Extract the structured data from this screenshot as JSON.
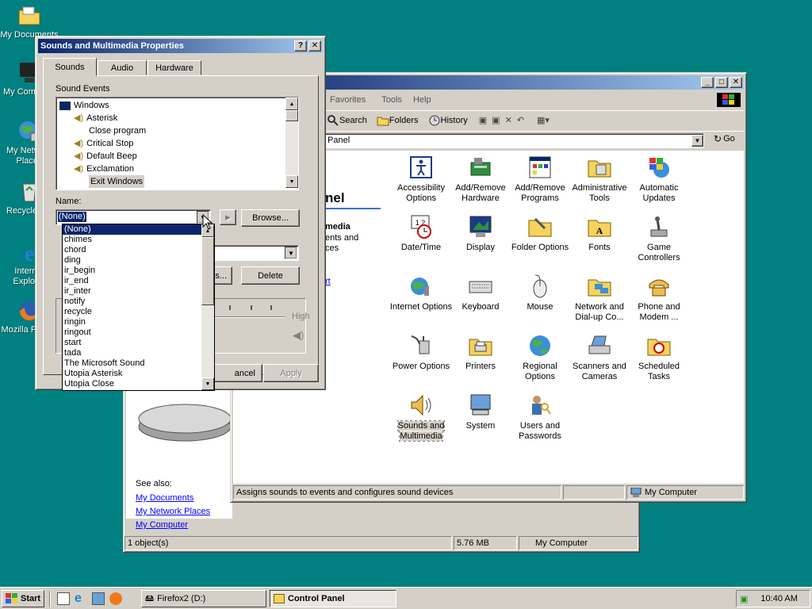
{
  "desktop": {
    "icons": [
      {
        "label": "My Documents"
      },
      {
        "label": "My Computer"
      },
      {
        "label": "My Network Places"
      },
      {
        "label": "Recycle Bin"
      },
      {
        "label": "Internet Explorer"
      },
      {
        "label": "Mozilla Firefox"
      }
    ]
  },
  "control_panel": {
    "menu": [
      "Favorites",
      "Tools",
      "Help"
    ],
    "toolbar": {
      "search": "Search",
      "folders": "Folders",
      "history": "History"
    },
    "address": "Panel",
    "go": "Go",
    "left_title": "nel",
    "left_subtitle": "media",
    "left_desc_1": "ents and",
    "left_desc_2": "ces",
    "left_link": "rt",
    "see_also": "See also:",
    "see_also_links": [
      "My Documents",
      "My Network Places",
      "My Computer"
    ],
    "items": [
      {
        "label": "Accessibility Options"
      },
      {
        "label": "Add/Remove Hardware"
      },
      {
        "label": "Add/Remove Programs"
      },
      {
        "label": "Administrative Tools"
      },
      {
        "label": "Automatic Updates"
      },
      {
        "label": "Date/Time"
      },
      {
        "label": "Display"
      },
      {
        "label": "Folder Options"
      },
      {
        "label": "Fonts"
      },
      {
        "label": "Game Controllers"
      },
      {
        "label": "Internet Options"
      },
      {
        "label": "Keyboard"
      },
      {
        "label": "Mouse"
      },
      {
        "label": "Network and Dial-up Co..."
      },
      {
        "label": "Phone and Modem ..."
      },
      {
        "label": "Power Options"
      },
      {
        "label": "Printers"
      },
      {
        "label": "Regional Options"
      },
      {
        "label": "Scanners and Cameras"
      },
      {
        "label": "Scheduled Tasks"
      },
      {
        "label": "Sounds and Multimedia"
      },
      {
        "label": "System"
      },
      {
        "label": "Users and Passwords"
      }
    ],
    "status_text": "Assigns sounds to events and configures sound devices",
    "status_zone": "My Computer",
    "outer_status": {
      "objects": "1 object(s)",
      "size": "5.76 MB",
      "zone": "My Computer"
    }
  },
  "dialog": {
    "title": "Sounds and Multimedia Properties",
    "help_btn": "?",
    "close_btn": "✕",
    "tabs": [
      "Sounds",
      "Audio",
      "Hardware"
    ],
    "group_label": "Sound Events",
    "events": [
      "Windows",
      "Asterisk",
      "Close program",
      "Critical Stop",
      "Default Beep",
      "Exclamation",
      "Exit Windows"
    ],
    "name_label": "Name:",
    "name_value": "(None)",
    "browse": "Browse...",
    "details": "s...",
    "delete": "Delete",
    "volume_high": "High",
    "cancel": "ancel",
    "apply": "Apply",
    "dropdown_options": [
      "(None)",
      "chimes",
      "chord",
      "ding",
      "ir_begin",
      "ir_end",
      "ir_inter",
      "notify",
      "recycle",
      "ringin",
      "ringout",
      "start",
      "tada",
      "The Microsoft Sound",
      "Utopia Asterisk",
      "Utopia Close"
    ]
  },
  "taskbar": {
    "start": "Start",
    "tasks": [
      "Firefox2 (D:)",
      "Control Panel"
    ],
    "clock": "10:40 AM"
  }
}
